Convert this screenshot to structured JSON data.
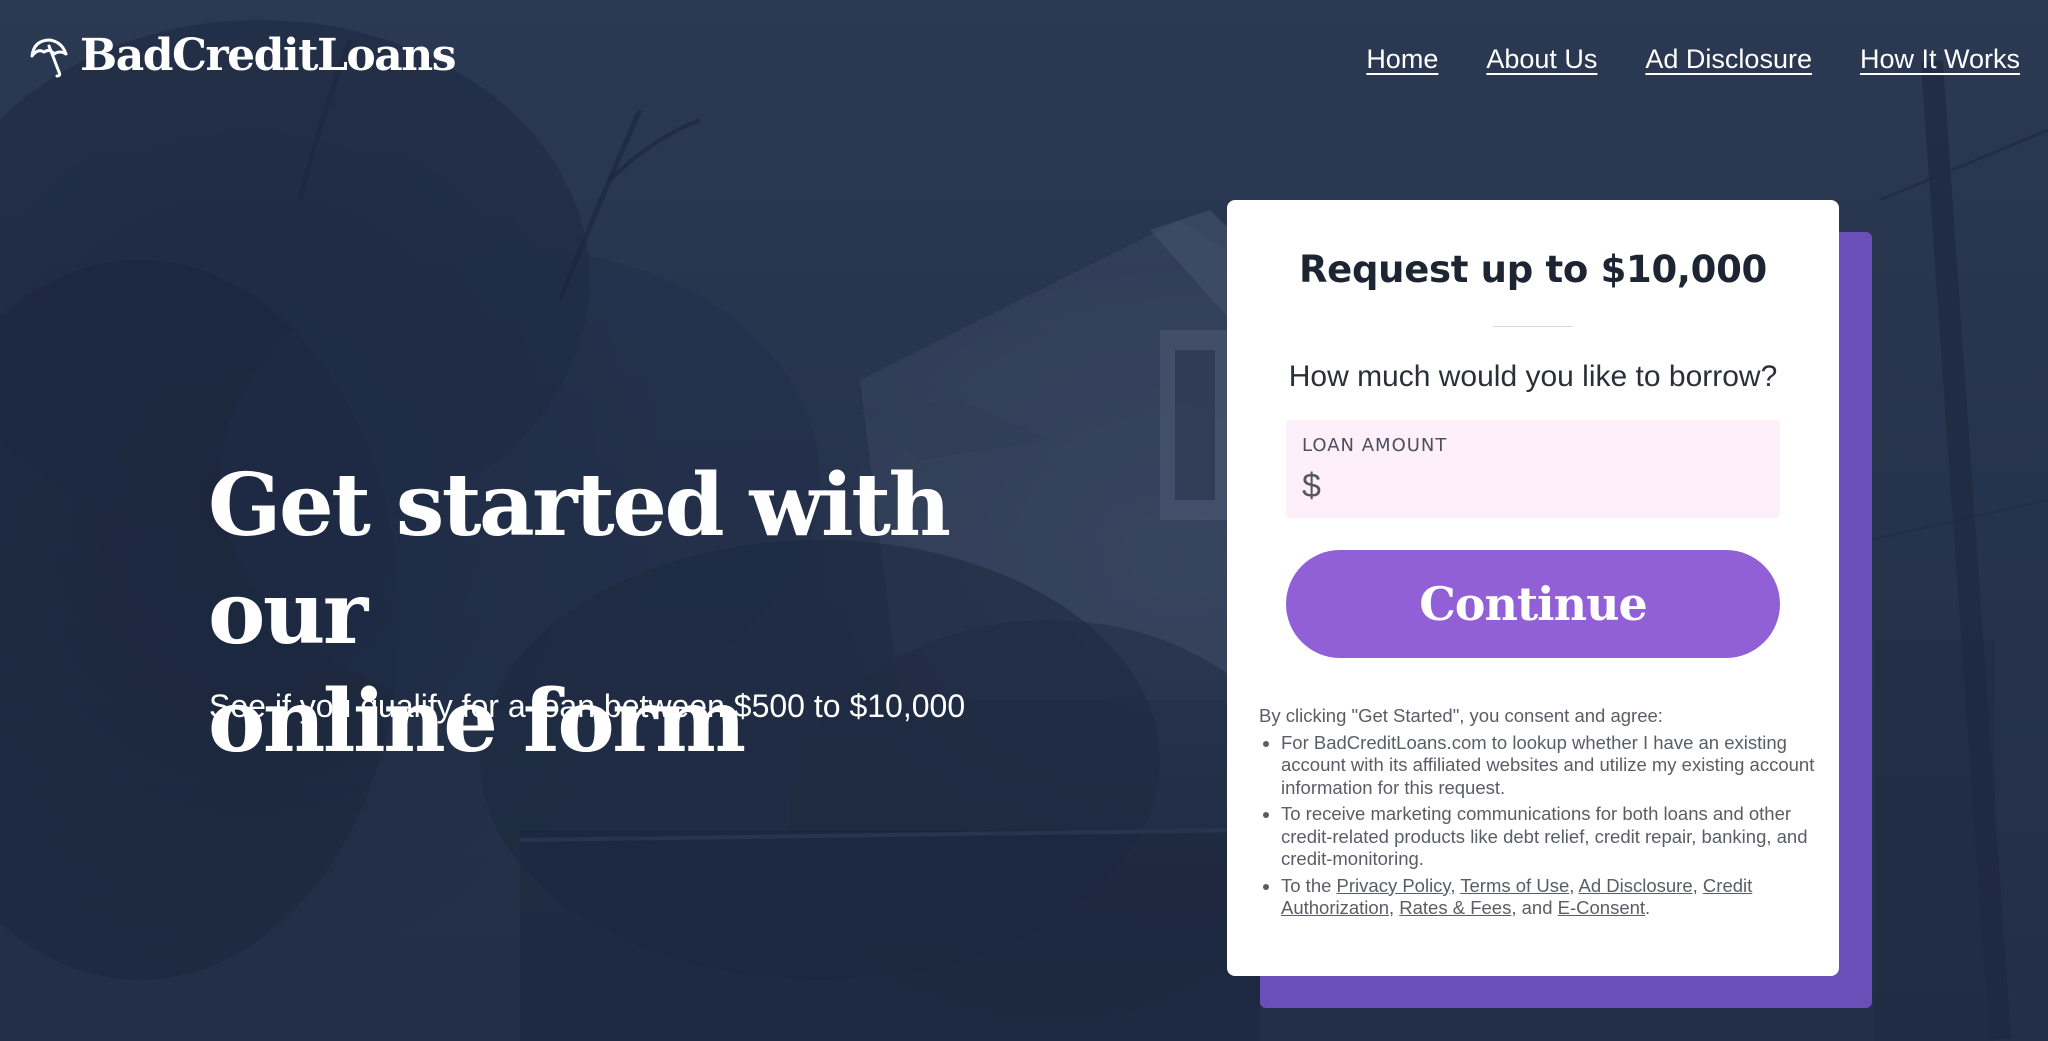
{
  "header": {
    "logo_text": "BadCreditLoans",
    "logo_icon": "umbrella-icon",
    "nav": [
      {
        "label": "Home"
      },
      {
        "label": "About Us"
      },
      {
        "label": "Ad Disclosure"
      },
      {
        "label": "How It Works"
      }
    ]
  },
  "hero": {
    "title_line1": "Get started with our",
    "title_line2": "online form",
    "subtitle": "See if you qualify for a loan between $500 to $10,000"
  },
  "form": {
    "title": "Request up to $10,000",
    "question": "How much would you like to borrow?",
    "amount_label": "LOAN AMOUNT",
    "currency_symbol": "$",
    "amount_value": "",
    "continue_label": "Continue",
    "consent": {
      "intro": "By clicking \"Get Started\", you consent and agree:",
      "item1": "For BadCreditLoans.com to lookup whether I have an existing account with its affiliated websites and utilize my existing account information for this request.",
      "item2": "To receive marketing communications for both loans and other credit-related products like debt relief, credit repair, banking, and credit-monitoring.",
      "item3_prefix": "To the ",
      "links": {
        "privacy_policy": "Privacy Policy",
        "terms_of_use": "Terms of Use",
        "ad_disclosure": "Ad Disclosure",
        "credit_authorization": "Credit Authorization",
        "rates_fees": "Rates & Fees",
        "e_consent": "E-Consent"
      },
      "sep_comma": ", ",
      "sep_and": ", and ",
      "end_period": "."
    }
  },
  "colors": {
    "accent_button": "#9160d6",
    "card_shadow": "#6a4fb8",
    "amount_bg": "#fdf0fb",
    "overlay": "#2a3852"
  }
}
